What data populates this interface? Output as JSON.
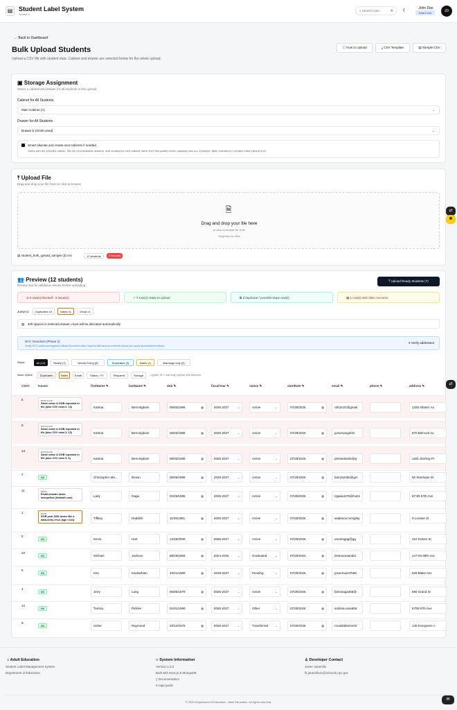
{
  "header": {
    "app_title": "Student Label System",
    "app_subtitle": "School 5",
    "search_placeholder": "Search Gaia...",
    "search_kbd": "⌘",
    "user_name": "John Doe",
    "user_role": "Data Lead",
    "avatar": "JD"
  },
  "page": {
    "back": "Back to Dashboard",
    "title": "Bulk Upload Students",
    "subtitle": "Upload a CSV file with student data. Cabinet and drawer are selected below for the whole upload.",
    "buttons": [
      "How to Upload",
      "CSV Template",
      "Sample CSV"
    ]
  },
  "storage": {
    "title": "Storage Assignment",
    "subtitle": "Select a cabinet and drawer for all students in this upload",
    "cabinet_label": "Cabinet for All Students",
    "cabinet_value": "Main Cabinet (A)",
    "drawer_label": "Drawer for All Students",
    "drawer_value": "Drawer E (0/400 used)",
    "smart_title": "Smart allocate and create next cabinets if needed",
    "smart_desc": "Starts with the selected drawer, fills the next available drawers, and creates the next cabinet name from this pattern when capacity runs out. Example: Main Cabinet A-C creates Main Cabinet D-H."
  },
  "upload": {
    "title": "Upload File",
    "subtitle": "Drag and drop your file here or click to browse",
    "drop_title": "Drag and drop your file here",
    "drop_sub": "or click to browse for a file",
    "drop_sub2": "Supports csv files",
    "file_name": "student_bulk_upload_sample (3).csv",
    "students_badge": "12 students",
    "issues_badge": "5 issue(s)"
  },
  "preview": {
    "title": "Preview (12 students)",
    "subtitle": "Review and fix validation issues before uploading.",
    "upload_button": "Upload Ready Students (7)",
    "summary": [
      "5 row(s) blocked - 5 issue(s)",
      "7 row(s) ready to upload",
      "3 duplicate / possible-dupe row(s)",
      "1 row(s) with date concerns"
    ],
    "jump_label": "Jump to:",
    "jump": [
      "Duplicates x3",
      "Dates x1",
      "Email x1"
    ],
    "info": "400 spaces in selected drawer; more will be allocated automatically",
    "nyc_title": "NYC Geoclient (Phase 2)",
    "nyc_desc": "Verify NYC addresses against official Geoclient data. Imports still save as entered unless you apply standardized values.",
    "verify": "Verify addresses",
    "show_label": "Show:",
    "show": [
      "All (12)",
      "Ready (7)",
      "Needs Fixing (5)",
      "Duplicates (3)",
      "Dates (1)",
      "Warnings only (0)"
    ],
    "issue_label": "Issue colors:",
    "issue_colors": [
      "Duplicates",
      "Dates",
      "Email",
      "Status / FY",
      "Required",
      "Storage"
    ],
    "issue_hint": "- Lighter fill = warning (upload still allowed)",
    "columns": [
      "CSV#",
      "Issues",
      "firstName",
      "lastName",
      "dob",
      "fiscalYear",
      "status",
      "startDate",
      "email",
      "phone",
      "address"
    ]
  },
  "rows": [
    {
      "n": "5",
      "issue_kind": "DUPLICATE",
      "issue": "Same name & DOB repeated in file (also CSV rows 6, 13)",
      "first": "Katrina",
      "last": "Bermingham",
      "dob": "05/03/1986",
      "fy": "2026-2027",
      "status": "Active",
      "start": "07/29/2026",
      "email": "raf12n21@gmail",
      "phone": "",
      "address": "1325 Atlantic Av"
    },
    {
      "n": "6",
      "issue_kind": "DUPLICATE",
      "issue": "Same name & DOB repeated in file (also CSV rows 5, 13)",
      "first": "Katrina",
      "last": "Bermingham",
      "dob": "05/03/1986",
      "fy": "2026-2027",
      "status": "Active",
      "start": "07/29/2026",
      "email": "juniorsangel34",
      "phone": "",
      "address": "970 Belmont Av"
    },
    {
      "n": "13",
      "issue_kind": "DUPLICATE",
      "issue": "Same name & DOB repeated in file (also CSV rows 5, 6)",
      "first": "Katrina",
      "last": "Bermingham",
      "dob": "05/03/1986",
      "fy": "2026-2027",
      "status": "Active",
      "start": "07/29/2026",
      "email": "johntedo845@g",
      "phone": "",
      "address": "1281 Sterling Pl"
    },
    {
      "n": "7",
      "issue_kind": "OK",
      "issue": "",
      "first": "Christopher Ma...",
      "last": "Brown",
      "dob": "05/05/1989",
      "fy": "2026-2027",
      "status": "Active",
      "start": "07/28/2026",
      "email": "barry52456@gm",
      "phone": "",
      "address": "50 Stanhope St"
    },
    {
      "n": "11",
      "issue_kind": "EMAIL",
      "issue": "Email domain looks misspelled (hotmail.com)",
      "first": "Lady",
      "last": "Gaga",
      "dob": "01/25/1995",
      "fy": "2026-2027",
      "status": "Active",
      "start": "07/29/2026",
      "email": "rigaaa4179@hotm",
      "phone": "",
      "address": "87-05 57th Ave"
    },
    {
      "n": "1",
      "issue_kind": "DATE",
      "issue": "DOB year 1881 looks like a data-entry error (age >144)",
      "first": "Tiffany",
      "last": "Haddish",
      "dob": "11/25/1881",
      "fy": "2026-2027",
      "status": "Active",
      "start": "07/29/2026",
      "email": "saldanca.mrnighty",
      "phone": "",
      "address": "9 Loraine St"
    },
    {
      "n": "2",
      "issue_kind": "OK",
      "issue": "",
      "first": "Kevin",
      "last": "Hart",
      "dob": "12/25/2000",
      "fy": "2026-2027",
      "status": "Active",
      "start": "07/29/2026",
      "email": "omariagag@gg",
      "phone": "",
      "address": "310 Robert St"
    },
    {
      "n": "10",
      "issue_kind": "OK",
      "issue": "",
      "first": "Michael",
      "last": "Jackson",
      "dob": "08/29/1958",
      "fy": "2024-2025",
      "status": "Graduated",
      "start": "07/29/2024",
      "email": "bestosaraandal",
      "phone": "",
      "address": "147-25 88th Ave"
    },
    {
      "n": "9",
      "issue_kind": "OK",
      "issue": "",
      "first": "Kim",
      "last": "Kardashian",
      "dob": "10/21/1980",
      "fy": "2026-2027",
      "status": "Pending",
      "start": "07/29/2026",
      "email": "josuemaza7560",
      "phone": "",
      "address": "629 Blake Ave"
    },
    {
      "n": "4",
      "issue_kind": "OK",
      "issue": "",
      "first": "Jerry",
      "last": "Lang",
      "dob": "05/05/1979",
      "fy": "2026-2027",
      "status": "Active",
      "start": "07/29/2026",
      "email": "barlosaga456@",
      "phone": "",
      "address": "690 Grand St"
    },
    {
      "n": "12",
      "issue_kind": "OK",
      "issue": "",
      "first": "Tommy",
      "last": "Pickles",
      "dob": "01/01/1990",
      "fy": "2026-2027",
      "status": "Other",
      "start": "07/28/2026",
      "email": "andrea.sosa656",
      "phone": "",
      "address": "6705 97th Ave"
    },
    {
      "n": "8",
      "issue_kind": "OK",
      "issue": "",
      "first": "Usher",
      "last": "Raymond",
      "dob": "10/14/1978",
      "fy": "2026-2027",
      "status": "Transferred",
      "start": "07/29/2026",
      "email": "ronaldabeirns43",
      "phone": "",
      "address": "148 Evergreen A"
    }
  ],
  "footer": {
    "col1_title": "Adult Education",
    "col1": [
      "Student Label Management System",
      "Department of Education"
    ],
    "col2_title": "System Information",
    "col2": [
      "Version 1.0.0",
      "Built with Next.js & MongoDB",
      "Documentation",
      "In-app guide"
    ],
    "col3_title": "Developer Contact",
    "col3": [
      "Javier Jaramillo",
      "fit.jaramillo11@schools.nyc.gov"
    ],
    "copyright": "© 2026 Department of Education - Adult Education. All rights reserved."
  },
  "colors": {
    "dup_bg": "#fdf2f2",
    "date_border": "#d97706",
    "ok_green": "#166534",
    "danger": "#ef4444"
  }
}
